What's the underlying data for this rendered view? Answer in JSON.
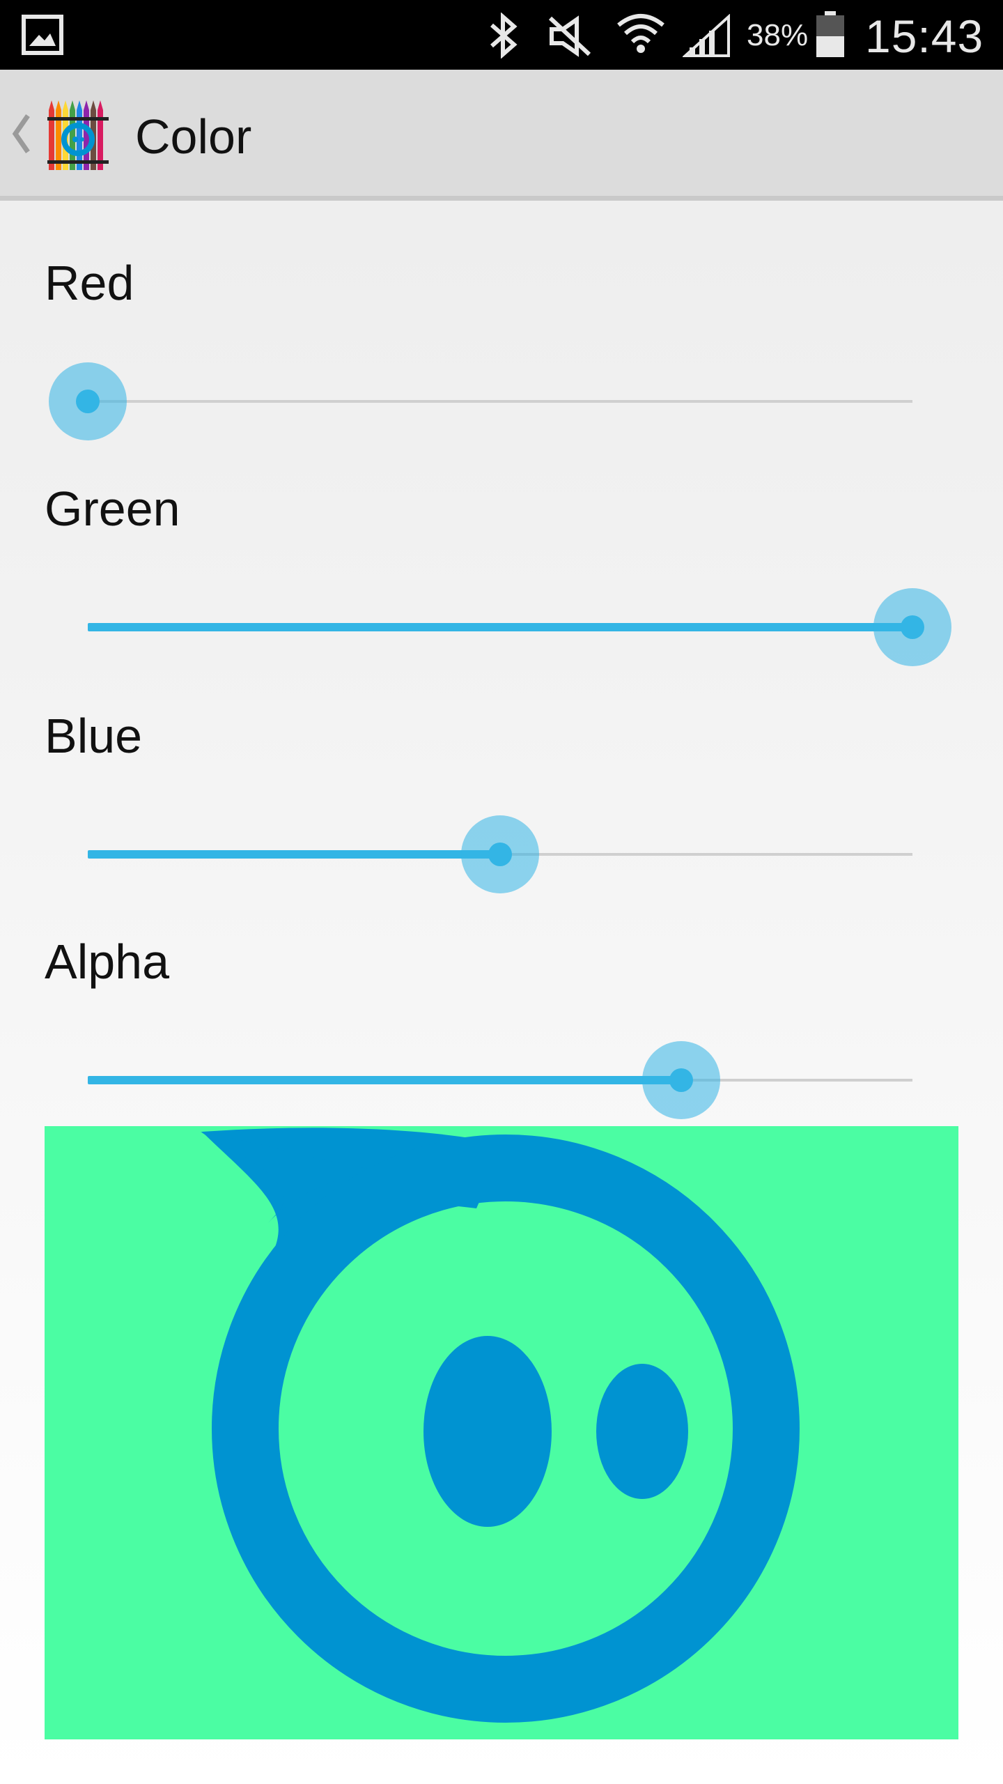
{
  "status_bar": {
    "battery_percent": "38%",
    "time": "15:43",
    "icons": [
      "gallery-icon",
      "bluetooth-icon",
      "mute-icon",
      "wifi-icon",
      "signal-icon",
      "battery-icon"
    ]
  },
  "action_bar": {
    "title": "Color",
    "app_icon": "crayons-icon",
    "back_icon": "chevron-left-icon"
  },
  "sliders": [
    {
      "label": "Red",
      "value": 0.0
    },
    {
      "label": "Green",
      "value": 1.0
    },
    {
      "label": "Blue",
      "value": 0.5
    },
    {
      "label": "Alpha",
      "value": 0.72
    }
  ],
  "colors": {
    "accent": "#33b5e5",
    "preview_background": "#4bfda3",
    "logo": "#0093d1"
  },
  "preview": {
    "logo_icon": "sphero-face-icon"
  }
}
